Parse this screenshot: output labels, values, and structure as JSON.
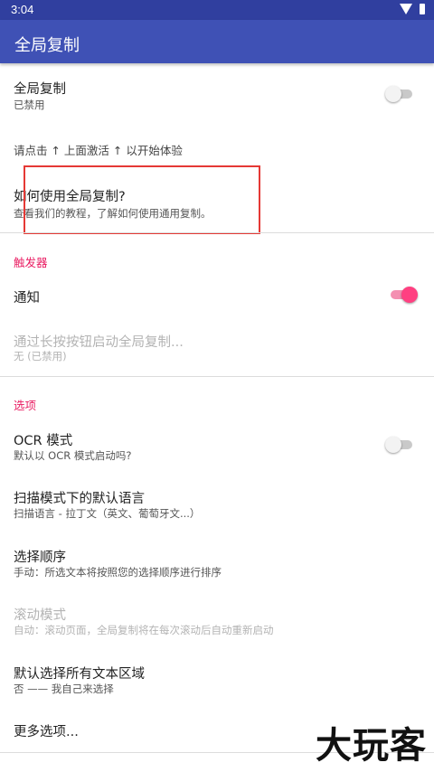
{
  "status": {
    "time": "3:04"
  },
  "appbar": {
    "title": "全局复制"
  },
  "main": {
    "global_copy": {
      "title": "全局复制",
      "summary": "已禁用",
      "enabled": false
    },
    "hint": "请点击 ↑ 上面激活 ↑ 以开始体验",
    "howto": {
      "title": "如何使用全局复制?",
      "summary": "查看我们的教程，了解如何使用通用复制。"
    }
  },
  "triggers": {
    "category": "触发器",
    "notification": {
      "title": "通知",
      "enabled": true
    },
    "long_press": {
      "title": "通过长按按钮启动全局复制...",
      "summary": "无 (已禁用)"
    }
  },
  "options": {
    "category": "选项",
    "ocr": {
      "title": "OCR 模式",
      "summary": "默认以 OCR 模式启动吗?",
      "enabled": false
    },
    "language": {
      "title": "扫描模式下的默认语言",
      "summary": "扫描语言 - 拉丁文（英文、葡萄牙文...）"
    },
    "order": {
      "title": "选择顺序",
      "summary": "手动：所选文本将按照您的选择顺序进行排序"
    },
    "scroll": {
      "title": "滚动模式",
      "summary": "自动：滚动页面，全局复制将在每次滚动后自动重新启动"
    },
    "select_all": {
      "title": "默认选择所有文本区域",
      "summary": "否 —— 我自己来选择"
    },
    "more": {
      "title": "更多选项..."
    }
  },
  "watermark": "大玩客",
  "colors": {
    "primary": "#3f51b5",
    "primary_dark": "#303f9f",
    "accent": "#ff4081",
    "highlight_border": "#e53935"
  }
}
